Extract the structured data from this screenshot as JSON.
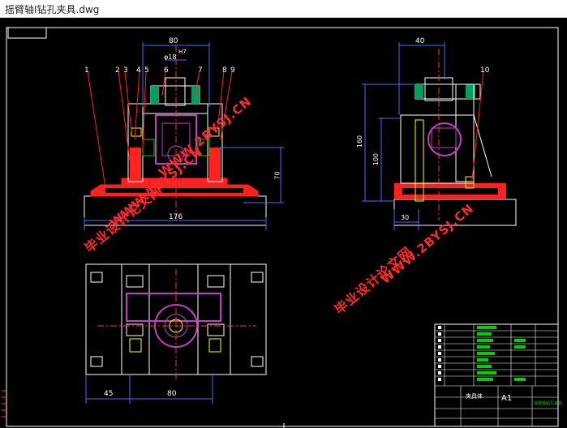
{
  "window": {
    "title": "摇臂轴I钻孔夹具.dwg"
  },
  "colors": {
    "canvas_bg": "#000000",
    "line_white": "#ffffff",
    "dim_blue": "#4a6bff",
    "section_red": "#ff2020",
    "part_magenta": "#c040c0",
    "centerline": "#ff3030",
    "yellow": "#ffff00",
    "green": "#00d000",
    "cyan": "#00e0e0",
    "watermark_red": "#ff2a2a"
  },
  "drawing": {
    "front_view": {
      "dims": {
        "width_top": "80",
        "bore": "φ18",
        "h7": "H7",
        "height_right": "70",
        "base_width": "176"
      },
      "balloons": [
        "1",
        "2",
        "3",
        "4",
        "5",
        "6",
        "7",
        "8",
        "9"
      ]
    },
    "side_view": {
      "dims": {
        "width_top": "40",
        "height_total": "160",
        "height_mid": "100",
        "base_left": "30"
      },
      "balloons": [
        "10"
      ]
    },
    "top_view": {
      "dims": {
        "left": "45",
        "mid": "80"
      }
    }
  },
  "watermarks": {
    "cn_text": "毕业设计论文网",
    "url_text": "WWW.2BYSJ.CN"
  },
  "title_block": {
    "drawing_name": "摇臂轴钻孔夹具",
    "size": "A1",
    "material": "夹具体"
  }
}
